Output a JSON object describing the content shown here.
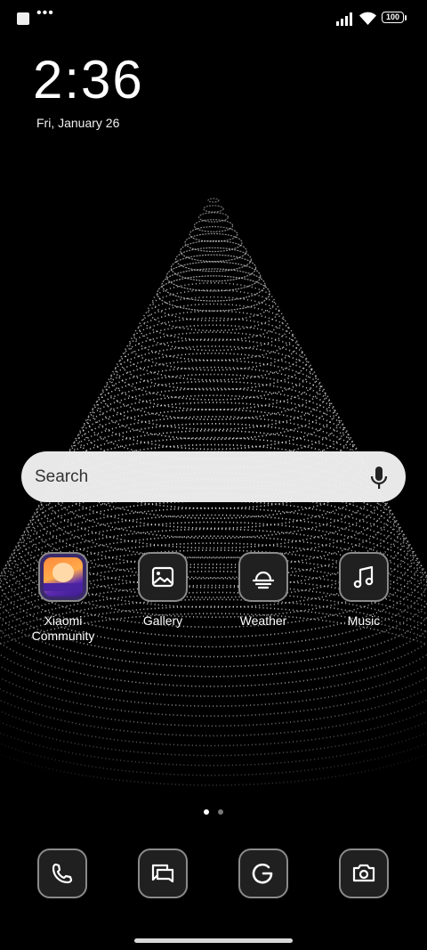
{
  "status_bar": {
    "notification_icons": [
      "square-notification-icon",
      "more-dots-icon"
    ],
    "dots_text": "•••",
    "signal": "signal-icon",
    "wifi": "wifi-icon",
    "battery_level": "100"
  },
  "lock": {
    "time": "2:36",
    "date": "Fri, January 26"
  },
  "search": {
    "placeholder": "Search",
    "mic_icon": "microphone-icon"
  },
  "apps": [
    {
      "label": "Xiaomi\nCommunity",
      "icon": "xiaomi-community-icon"
    },
    {
      "label": "Gallery",
      "icon": "gallery-icon"
    },
    {
      "label": "Weather",
      "icon": "weather-icon"
    },
    {
      "label": "Music",
      "icon": "music-icon"
    }
  ],
  "pages": {
    "count": 2,
    "current": 1
  },
  "dock": [
    {
      "icon": "phone-icon"
    },
    {
      "icon": "messages-icon"
    },
    {
      "icon": "google-icon"
    },
    {
      "icon": "camera-icon"
    }
  ],
  "colors": {
    "background": "#000000",
    "search_bg": "#f0f0f0",
    "tile_border": "#8a8a8a"
  }
}
